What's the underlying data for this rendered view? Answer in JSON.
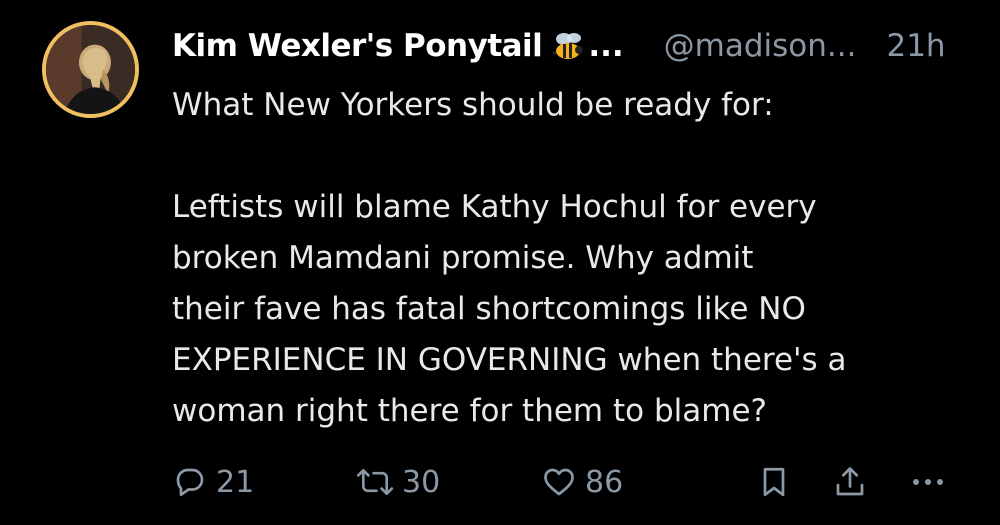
{
  "tweet": {
    "author": {
      "display_name": "Kim Wexler's Ponytail",
      "name_emoji": "bee-icon",
      "name_truncation": "...",
      "handle": "@madison...",
      "time": "21h"
    },
    "text_lines": [
      "What New Yorkers should be ready for:",
      "",
      "Leftists will blame Kathy Hochul for every",
      "broken Mamdani promise. Why admit",
      "their fave has fatal shortcomings like NO",
      "EXPERIENCE IN GOVERNING when there's a",
      "woman right there for them to blame?"
    ],
    "actions": {
      "reply_count": "21",
      "retweet_count": "30",
      "like_count": "86"
    }
  },
  "colors": {
    "background": "#000000",
    "primary_text": "#e7e9ea",
    "secondary_text": "#8b98a5",
    "avatar_ring": "#f0c060"
  }
}
